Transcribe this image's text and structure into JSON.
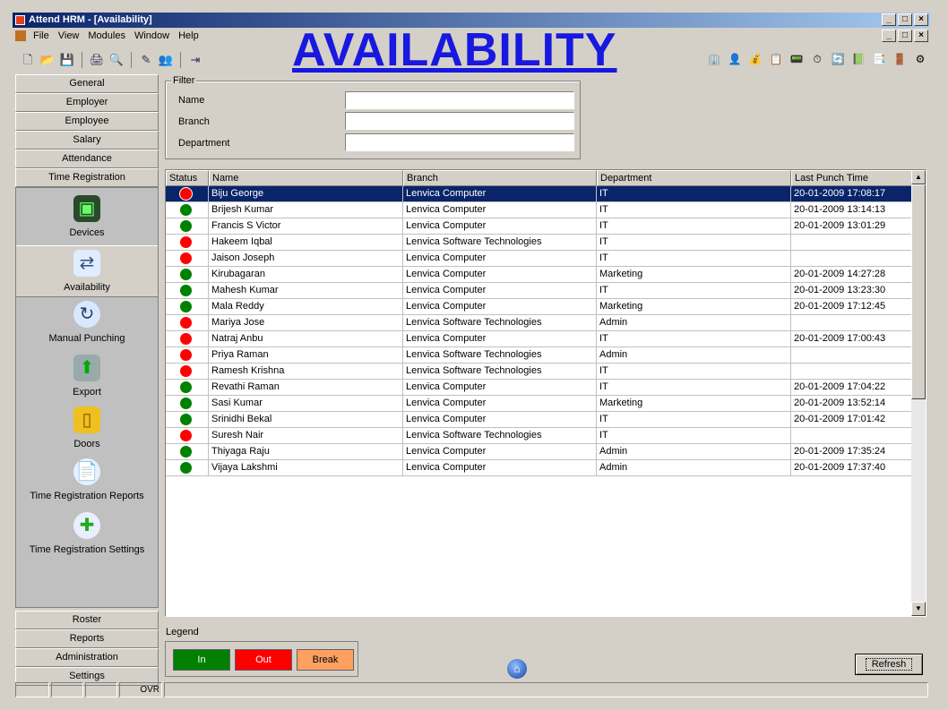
{
  "window": {
    "title": "Attend HRM - [Availability]"
  },
  "menu": [
    "File",
    "View",
    "Modules",
    "Window",
    "Help"
  ],
  "heading": "AVAILABILITY",
  "sidebar": {
    "top_buttons": [
      "General",
      "Employer",
      "Employee",
      "Salary",
      "Attendance",
      "Time Registration"
    ],
    "items": [
      {
        "label": "Devices",
        "icon": "device-icon"
      },
      {
        "label": "Availability",
        "icon": "availability-icon"
      },
      {
        "label": "Manual Punching",
        "icon": "manual-punch-icon"
      },
      {
        "label": "Export",
        "icon": "export-icon"
      },
      {
        "label": "Doors",
        "icon": "door-icon"
      },
      {
        "label": "Time Registration Reports",
        "icon": "report-icon"
      },
      {
        "label": "Time Registration Settings",
        "icon": "settings-icon"
      }
    ],
    "bottom_buttons": [
      "Roster",
      "Reports",
      "Administration",
      "Settings"
    ]
  },
  "filter": {
    "legend": "Filter",
    "name_label": "Name",
    "branch_label": "Branch",
    "department_label": "Department",
    "name_value": "",
    "branch_value": "",
    "department_value": ""
  },
  "table": {
    "columns": [
      "Status",
      "Name",
      "Branch",
      "Department",
      "Last Punch Time"
    ],
    "rows": [
      {
        "status": "out",
        "name": "Biju George",
        "branch": "Lenvica Computer",
        "department": "IT",
        "last_punch": "20-01-2009 17:08:17"
      },
      {
        "status": "in",
        "name": "Brijesh Kumar",
        "branch": "Lenvica Computer",
        "department": "IT",
        "last_punch": "20-01-2009 13:14:13"
      },
      {
        "status": "in",
        "name": "Francis S  Victor",
        "branch": "Lenvica Computer",
        "department": "IT",
        "last_punch": "20-01-2009 13:01:29"
      },
      {
        "status": "out",
        "name": "Hakeem Iqbal",
        "branch": "Lenvica Software Technologies",
        "department": "IT",
        "last_punch": ""
      },
      {
        "status": "out",
        "name": "Jaison Joseph",
        "branch": "Lenvica Computer",
        "department": "IT",
        "last_punch": ""
      },
      {
        "status": "in",
        "name": "Kirubagaran",
        "branch": "Lenvica Computer",
        "department": "Marketing",
        "last_punch": "20-01-2009 14:27:28"
      },
      {
        "status": "in",
        "name": "Mahesh Kumar",
        "branch": "Lenvica Computer",
        "department": "IT",
        "last_punch": "20-01-2009 13:23:30"
      },
      {
        "status": "in",
        "name": "Mala Reddy",
        "branch": "Lenvica Computer",
        "department": "Marketing",
        "last_punch": "20-01-2009 17:12:45"
      },
      {
        "status": "out",
        "name": "Mariya Jose",
        "branch": "Lenvica Software Technologies",
        "department": "Admin",
        "last_punch": ""
      },
      {
        "status": "out",
        "name": "Natraj Anbu",
        "branch": "Lenvica Computer",
        "department": "IT",
        "last_punch": "20-01-2009 17:00:43"
      },
      {
        "status": "out",
        "name": "Priya Raman",
        "branch": "Lenvica Software Technologies",
        "department": "Admin",
        "last_punch": ""
      },
      {
        "status": "out",
        "name": "Ramesh Krishna",
        "branch": "Lenvica Software Technologies",
        "department": "IT",
        "last_punch": ""
      },
      {
        "status": "in",
        "name": "Revathi Raman",
        "branch": "Lenvica Computer",
        "department": "IT",
        "last_punch": "20-01-2009 17:04:22"
      },
      {
        "status": "in",
        "name": "Sasi Kumar",
        "branch": "Lenvica Computer",
        "department": "Marketing",
        "last_punch": "20-01-2009 13:52:14"
      },
      {
        "status": "in",
        "name": "Srinidhi Bekal",
        "branch": "Lenvica Computer",
        "department": "IT",
        "last_punch": "20-01-2009 17:01:42"
      },
      {
        "status": "out",
        "name": "Suresh Nair",
        "branch": "Lenvica Software Technologies",
        "department": "IT",
        "last_punch": ""
      },
      {
        "status": "in",
        "name": "Thiyaga Raju",
        "branch": "Lenvica Computer",
        "department": "Admin",
        "last_punch": "20-01-2009 17:35:24"
      },
      {
        "status": "in",
        "name": "Vijaya  Lakshmi",
        "branch": "Lenvica Computer",
        "department": "Admin",
        "last_punch": "20-01-2009 17:37:40"
      }
    ],
    "selected_row": 0
  },
  "legend": {
    "label": "Legend",
    "in_label": "In",
    "out_label": "Out",
    "break_label": "Break"
  },
  "colors": {
    "in": "#008000",
    "out": "#ff0000",
    "break": "#ffa060",
    "selection": "#0a246a"
  },
  "buttons": {
    "refresh": "Refresh"
  },
  "statusbar": {
    "mode": "OVR"
  }
}
